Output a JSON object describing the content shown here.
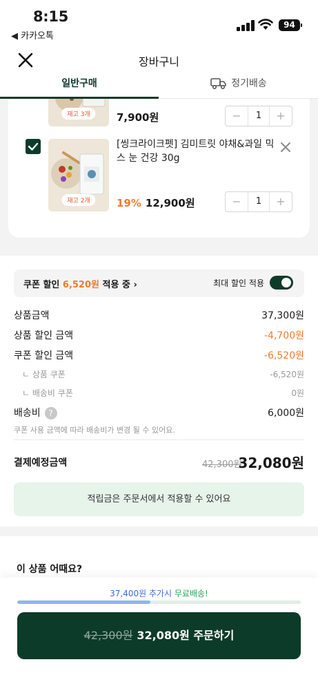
{
  "status": {
    "time": "8:15",
    "back_app": "◀ 카카오톡",
    "battery": "94"
  },
  "header": {
    "title": "장바구니"
  },
  "tabs": [
    {
      "label": "일반구매"
    },
    {
      "label": "정기배송"
    }
  ],
  "cart": {
    "items": [
      {
        "stock": "재고 3개",
        "price": "7,900원",
        "qty": "1"
      },
      {
        "checked": true,
        "name": "[씽크라이크펫] 김미트릿 야채&과일 믹스 눈 건강 30g",
        "stock": "재고 2개",
        "discount": "19%",
        "price": "12,900원",
        "qty": "1"
      }
    ],
    "stepper_minus": "−",
    "stepper_plus": "+"
  },
  "coupon": {
    "prefix": "쿠폰 할인 ",
    "amount": "6,520원",
    "suffix": " 적용 중 ›",
    "max_label": "최대 할인 적용",
    "toggle_on": true
  },
  "summary": {
    "product_amount_label": "상품금액",
    "product_amount": "37,300원",
    "product_discount_label": "상품 할인 금액",
    "product_discount": "-4,700원",
    "coupon_discount_label": "쿠폰 할인 금액",
    "coupon_discount": "-6,520원",
    "product_coupon_label": "ㄴ 상품 쿠폰",
    "product_coupon": "-6,520원",
    "shipping_coupon_label": "ㄴ 배송비 쿠폰",
    "shipping_coupon": "0원",
    "shipping_label": "배송비",
    "shipping_fee": "6,000원",
    "note": "쿠폰 사용 금액에 따라 배송비가 변경 될 수 있어요.",
    "total_label": "결제예정금액",
    "total_original": "42,300원",
    "total_final": "32,080원"
  },
  "points_notice": "적립금은 주문서에서 적용할 수 있어요",
  "recommend_title": "이 상품 어때요?",
  "bottom": {
    "freeship_amount": "37,400원 추가시 ",
    "freeship_suffix": "무료배송!",
    "progress": 0.47,
    "order_original": "42,300원",
    "order_label": "32,080원 주문하기"
  },
  "colors": {
    "brand": "#0d3b2a",
    "accent": "#f07b2c",
    "notice_bg": "#e6f4ea"
  }
}
